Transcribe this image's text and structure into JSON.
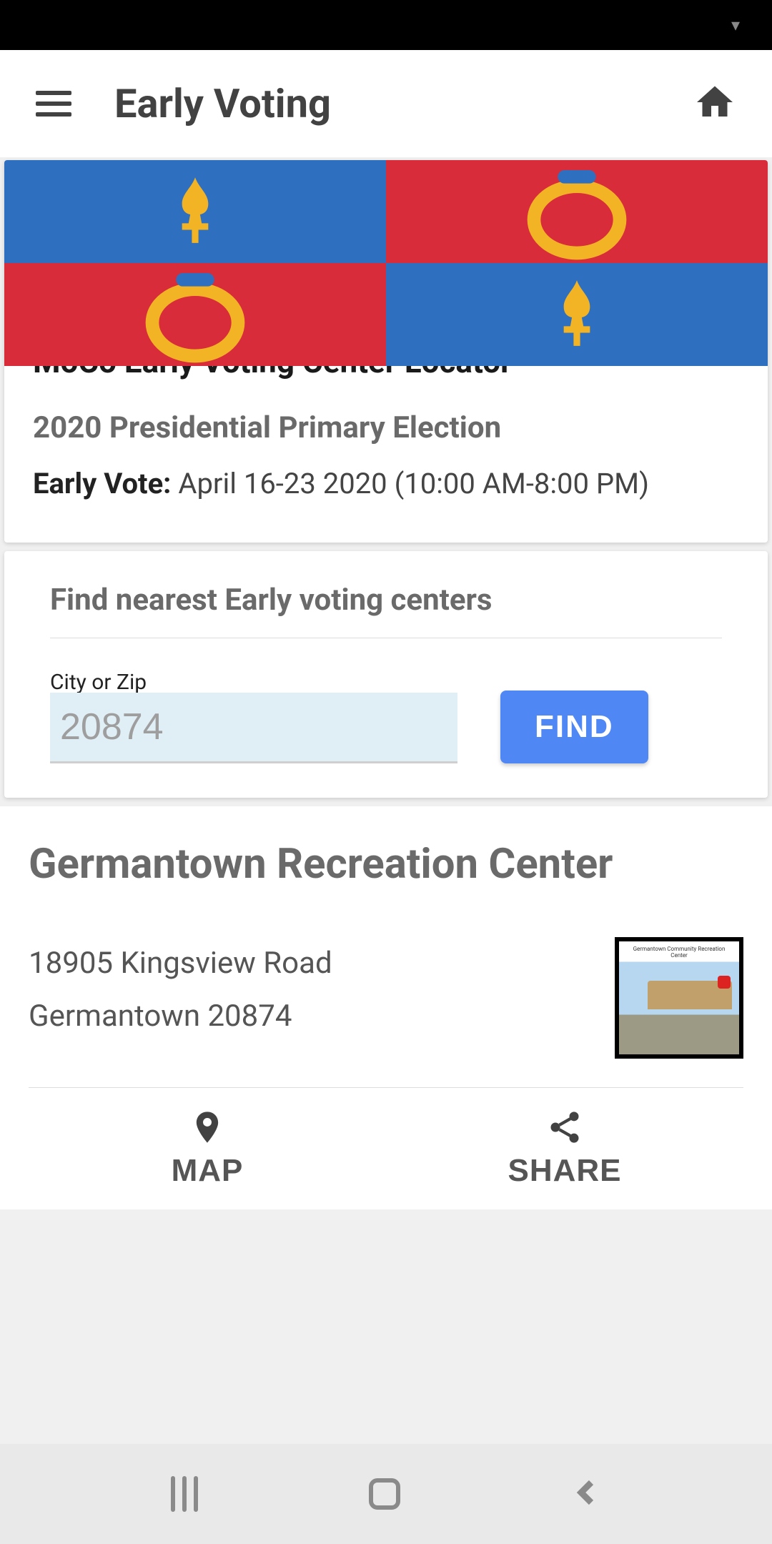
{
  "app": {
    "title": "Early Voting"
  },
  "locator": {
    "heading": "MoCo Early Voting Center Locator",
    "election": "2020 Presidential Primary Election",
    "early_vote_label": "Early Vote:",
    "early_vote_dates": " April 16-23 2020 (10:00 AM-8:00 PM)"
  },
  "search": {
    "heading": "Find nearest Early voting centers",
    "input_label": "City or Zip",
    "input_value": "20874",
    "button_label": "FIND"
  },
  "result": {
    "name": "Germantown Recreation Center",
    "address_line1": "18905 Kingsview Road",
    "address_line2": "Germantown 20874",
    "thumb_label": "Germantown Community Recreation Center"
  },
  "actions": {
    "map": "MAP",
    "share": "SHARE"
  },
  "icons": {
    "menu": "menu-icon",
    "home": "home-icon",
    "pin": "pin-icon",
    "share": "share-icon"
  },
  "colors": {
    "accent": "#4f87f5",
    "flag_blue": "#2f6fc0",
    "flag_red": "#d82c3a",
    "flag_gold": "#f2b425"
  }
}
